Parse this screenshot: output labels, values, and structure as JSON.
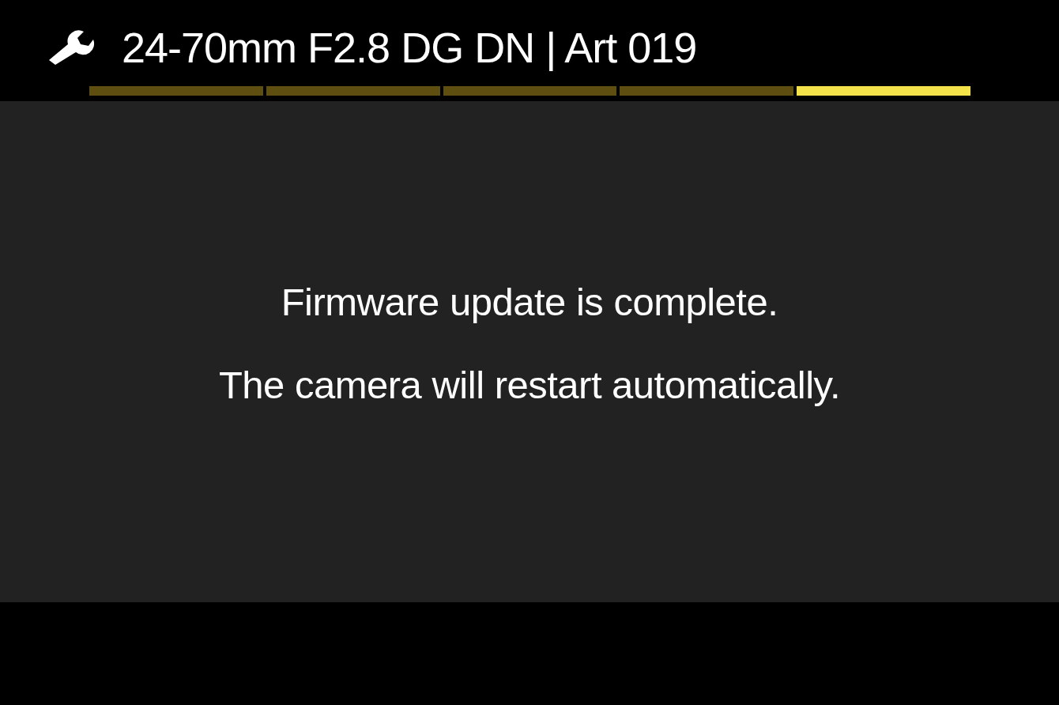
{
  "header": {
    "title": "24-70mm F2.8 DG DN | Art 019"
  },
  "tabs": [
    {
      "selected": false
    },
    {
      "selected": false
    },
    {
      "selected": false
    },
    {
      "selected": false
    },
    {
      "selected": true
    }
  ],
  "message": {
    "lines": [
      "Firmware update is complete.",
      "The camera will restart automatically."
    ]
  }
}
